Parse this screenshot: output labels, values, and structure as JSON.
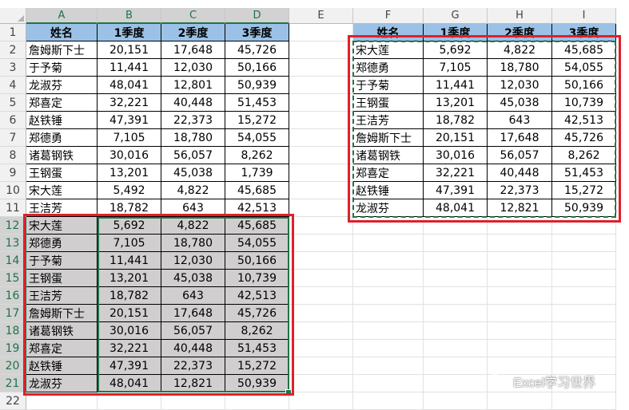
{
  "columns": [
    "A",
    "B",
    "C",
    "D",
    "E",
    "F",
    "G",
    "H",
    "I"
  ],
  "selected_columns": [
    "A",
    "B",
    "C",
    "D"
  ],
  "rows": [
    "1",
    "2",
    "3",
    "4",
    "5",
    "6",
    "7",
    "8",
    "9",
    "10",
    "11",
    "12",
    "13",
    "14",
    "15",
    "16",
    "17",
    "18",
    "19",
    "20",
    "21",
    "22"
  ],
  "selected_rows": [
    "12",
    "13",
    "14",
    "15",
    "16",
    "17",
    "18",
    "19",
    "20",
    "21"
  ],
  "left_table": {
    "headers": [
      "姓名",
      "1季度",
      "2季度",
      "3季度"
    ],
    "rows": [
      [
        "詹姆斯下士",
        "20,151",
        "17,648",
        "45,726"
      ],
      [
        "于予菊",
        "11,441",
        "12,030",
        "50,166"
      ],
      [
        "龙淑芬",
        "48,041",
        "12,801",
        "50,939"
      ],
      [
        "郑喜定",
        "32,221",
        "40,448",
        "51,453"
      ],
      [
        "赵铁锤",
        "47,391",
        "22,373",
        "15,272"
      ],
      [
        "郑德勇",
        "7,105",
        "18,780",
        "54,055"
      ],
      [
        "诸葛钢铁",
        "30,016",
        "56,057",
        "8,262"
      ],
      [
        "王钢蛋",
        "13,201",
        "45,038",
        "1,739"
      ],
      [
        "宋大莲",
        "5,492",
        "4,822",
        "45,685"
      ],
      [
        "王洁芳",
        "18,782",
        "643",
        "42,513"
      ]
    ]
  },
  "left_filtered_rows": [
    [
      "宋大莲",
      "5,692",
      "4,822",
      "45,685"
    ],
    [
      "郑德勇",
      "7,105",
      "18,780",
      "54,055"
    ],
    [
      "于予菊",
      "11,441",
      "12,030",
      "50,166"
    ],
    [
      "王钢蛋",
      "13,201",
      "45,038",
      "10,739"
    ],
    [
      "王洁芳",
      "18,782",
      "643",
      "42,513"
    ],
    [
      "詹姆斯下士",
      "20,151",
      "17,648",
      "45,726"
    ],
    [
      "诸葛钢铁",
      "30,016",
      "56,057",
      "8,262"
    ],
    [
      "郑喜定",
      "32,221",
      "40,448",
      "51,453"
    ],
    [
      "赵铁锤",
      "47,391",
      "22,373",
      "15,272"
    ],
    [
      "龙淑芬",
      "48,041",
      "12,821",
      "50,939"
    ]
  ],
  "right_table": {
    "headers": [
      "姓名",
      "1季度",
      "2季度",
      "3季度"
    ],
    "rows": [
      [
        "宋大莲",
        "5,692",
        "4,822",
        "45,685"
      ],
      [
        "郑德勇",
        "7,105",
        "18,780",
        "54,055"
      ],
      [
        "于予菊",
        "11,441",
        "12,030",
        "50,166"
      ],
      [
        "王钢蛋",
        "13,201",
        "45,038",
        "10,739"
      ],
      [
        "王洁芳",
        "18,782",
        "643",
        "42,513"
      ],
      [
        "詹姆斯下士",
        "20,151",
        "17,648",
        "45,726"
      ],
      [
        "诸葛钢铁",
        "30,016",
        "56,057",
        "8,262"
      ],
      [
        "郑喜定",
        "32,221",
        "40,448",
        "51,453"
      ],
      [
        "赵铁锤",
        "47,391",
        "22,373",
        "15,272"
      ],
      [
        "龙淑芬",
        "48,041",
        "12,821",
        "50,939"
      ]
    ]
  },
  "watermark": "Excel学习世界",
  "colors": {
    "header_fill": "#9bc2e6",
    "gray_fill": "#d0cece",
    "highlight_red": "#e0202a",
    "excel_green": "#217346"
  }
}
